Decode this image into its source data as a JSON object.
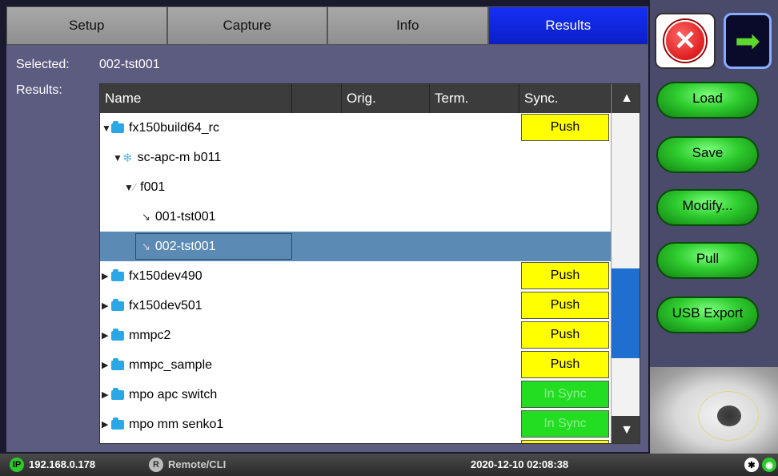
{
  "tabs": [
    "Setup",
    "Capture",
    "Info",
    "Results"
  ],
  "selected_label": "Selected:",
  "selected_value": "002-tst001",
  "results_label": "Results:",
  "columns": [
    "Name",
    "",
    "Orig.",
    "Term.",
    "Sync."
  ],
  "rows": [
    {
      "name": "fx150build64_rc",
      "sync": "Push"
    },
    {
      "name": "sc-apc-m b011",
      "sync": ""
    },
    {
      "name": "f001",
      "sync": ""
    },
    {
      "name": "001-tst001",
      "sync": ""
    },
    {
      "name": "002-tst001",
      "sync": ""
    },
    {
      "name": "fx150dev490",
      "sync": "Push"
    },
    {
      "name": "fx150dev501",
      "sync": "Push"
    },
    {
      "name": "mmpc2",
      "sync": "Push"
    },
    {
      "name": "mmpc_sample",
      "sync": "Push"
    },
    {
      "name": "mpo apc switch",
      "sync": "In Sync"
    },
    {
      "name": "mpo mm senko1",
      "sync": "In Sync"
    }
  ],
  "buttons": {
    "load": "Load",
    "save": "Save",
    "modify": "Modify...",
    "pull": "Pull",
    "usb_export": "USB Export"
  },
  "status": {
    "ip_badge": "IP",
    "ip": "192.168.0.178",
    "remote_badge": "R",
    "remote": "Remote/CLI",
    "datetime": "2020-12-10  02:08:38"
  },
  "colors": {
    "active_tab": "#1530f5",
    "push": "#ffff00",
    "in_sync": "#22dd22",
    "selected_row": "#5b8bb5"
  }
}
